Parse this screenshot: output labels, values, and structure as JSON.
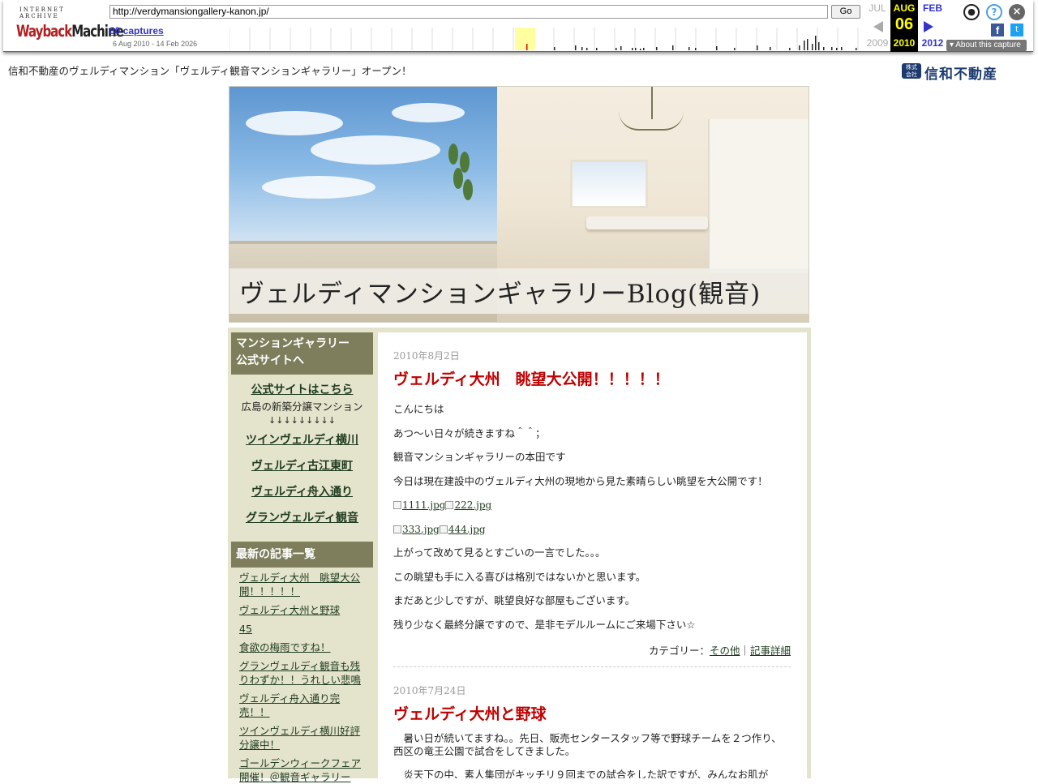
{
  "wayback": {
    "logo_top": "INTERNET ARCHIVE",
    "logo_main_a": "Wayback",
    "logo_main_b": "Machine",
    "url": "http://verdymansiongallery-kanon.jp/",
    "go": "Go",
    "captures": "80 captures",
    "range": "6 Aug 2010 - 14 Feb 2026",
    "prev_month": "JUL",
    "prev_year": "2009",
    "cur_month": "AUG",
    "cur_day": "06",
    "cur_year": "2010",
    "next_month": "FEB",
    "next_year": "2012",
    "about": "About this capture",
    "fb": "f",
    "tw": "t"
  },
  "header": {
    "tagline": "信和不動産のヴェルディマンション「ヴェルディ観音マンションギャラリー」オープン！",
    "brand_mark": "株式\n会社",
    "brand_name": "信和不動産"
  },
  "banner": {
    "title": "ヴェルディマンションギャラリーBlog(観音)"
  },
  "sidebar": {
    "head1_line1": "マンションギャラリー",
    "head1_line2": "公式サイトへ",
    "official_link": "公式サイトはこちら",
    "official_sub": "広島の新築分譲マンション",
    "arrows": "↓↓↓↓↓↓↓↓↓",
    "links": [
      "ツインヴェルディ横川",
      "ヴェルディ古江東町",
      "ヴェルディ舟入通り",
      "グランヴェルディ観音"
    ],
    "head2": "最新の記事一覧",
    "recent": [
      "ヴェルディ大州　眺望大公開！！！！！",
      "ヴェルディ大州と野球",
      "45",
      "食欲の梅雨ですね！",
      "グランヴェルディ観音も残りわずか！！うれしい悲鳴",
      "ヴェルディ舟入通り完売！！",
      "ツインヴェルディ横川好評分譲中！",
      "ゴールデンウィークフェア開催！＠観音ギャラリー"
    ]
  },
  "posts": [
    {
      "date": "2010年8月2日",
      "title": "ヴェルディ大州　眺望大公開！！！！！",
      "p1": "こんにちは",
      "p2": "あつ～い日々が続きますね＾＾；",
      "p3": "観音マンションギャラリーの本田です",
      "p4": "今日は現在建設中のヴェルディ大州の現地から見た素晴らしい眺望を大公開です！",
      "img1": "1111.jpg",
      "img2": "222.jpg",
      "img3": "333.jpg",
      "img4": "444.jpg",
      "p5": "上がって改めて見るとすごいの一言でした。。。",
      "p6": "この眺望も手に入る喜びは格別ではないかと思います。",
      "p7": "まだあと少しですが、眺望良好な部屋もございます。",
      "p8": "残り少なく最終分譲ですので、是非モデルルームにご来場下さい☆",
      "cat_label": "カテゴリー：",
      "cat": "その他",
      "sep": "｜",
      "detail": "記事詳細"
    },
    {
      "date": "2010年7月24日",
      "title": "ヴェルディ大州と野球",
      "p1": "　暑い日が続いてますね。。先日、販売センタースタッフ等で野球チームを２つ作り、西区の竜王公園で試合をしてきました。",
      "p2": "　炎天下の中、素人集団がキッチリ９回までの試合をした訳ですが、みんなお肌が"
    }
  ]
}
